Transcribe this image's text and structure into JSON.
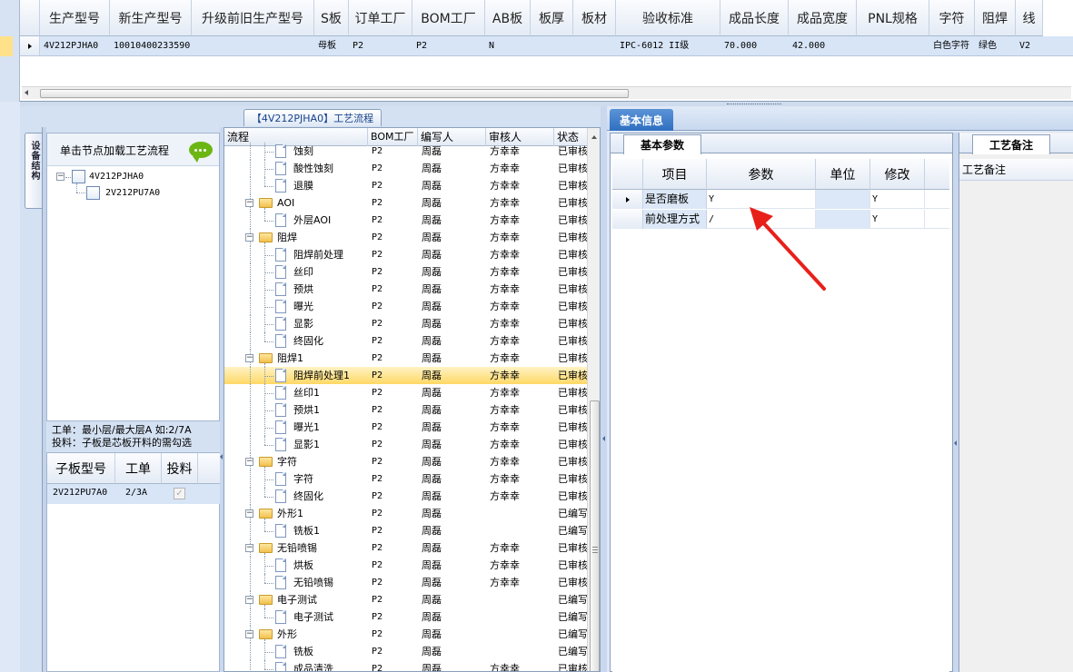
{
  "top_grid": {
    "columns": [
      "生产型号",
      "新生产型号",
      "升级前旧生产型号",
      "S板",
      "订单工厂",
      "BOM工厂",
      "AB板",
      "板厚",
      "板材",
      "验收标准",
      "成品长度",
      "成品宽度",
      "PNL规格",
      "字符",
      "阻焊",
      "线"
    ],
    "row": [
      "4V212PJHA0",
      "10010400233590",
      "",
      "母板",
      "P2",
      "P2",
      "N",
      "",
      "",
      "IPC-6012 II级",
      "70.000",
      "42.000",
      "",
      "白色字符",
      "绿色",
      "V2"
    ]
  },
  "left_panel": {
    "vertical_tab": "设备结构",
    "process_tab_title": "【4V212PJHA0】工艺流程",
    "node_hint": "单击节点加载工艺流程",
    "tree": [
      {
        "label": "4V212PJHA0"
      },
      {
        "label": "2V212PU7A0"
      }
    ],
    "info_line1": "工单：最小层/最大层A 如:2/7A",
    "info_line2": "投料：子板是芯板开料的需勾选",
    "sub_grid": {
      "columns": [
        "子板型号",
        "工单",
        "投料"
      ],
      "rows": [
        {
          "model": "2V212PU7A0",
          "order": "2/3A",
          "feed_checked": true
        }
      ]
    }
  },
  "process_tree": {
    "columns": [
      "流程",
      "BOM工厂",
      "编写人",
      "审核人",
      "状态"
    ],
    "rows": [
      {
        "level": 2,
        "kind": "doc",
        "name": "蚀刻",
        "bom": "P2",
        "writer": "周磊",
        "reviewer": "方幸幸",
        "status": "已审核"
      },
      {
        "level": 2,
        "kind": "doc",
        "name": "酸性蚀刻",
        "bom": "P2",
        "writer": "周磊",
        "reviewer": "方幸幸",
        "status": "已审核"
      },
      {
        "level": 2,
        "kind": "doc",
        "name": "退膜",
        "bom": "P2",
        "writer": "周磊",
        "reviewer": "方幸幸",
        "status": "已审核"
      },
      {
        "level": 1,
        "kind": "folder",
        "name": "AOI",
        "bom": "P2",
        "writer": "周磊",
        "reviewer": "方幸幸",
        "status": "已审核"
      },
      {
        "level": 2,
        "kind": "doc",
        "name": "外层AOI",
        "bom": "P2",
        "writer": "周磊",
        "reviewer": "方幸幸",
        "status": "已审核"
      },
      {
        "level": 1,
        "kind": "folder",
        "name": "阻焊",
        "bom": "P2",
        "writer": "周磊",
        "reviewer": "方幸幸",
        "status": "已审核"
      },
      {
        "level": 2,
        "kind": "doc",
        "name": "阻焊前处理",
        "bom": "P2",
        "writer": "周磊",
        "reviewer": "方幸幸",
        "status": "已审核"
      },
      {
        "level": 2,
        "kind": "doc",
        "name": "丝印",
        "bom": "P2",
        "writer": "周磊",
        "reviewer": "方幸幸",
        "status": "已审核"
      },
      {
        "level": 2,
        "kind": "doc",
        "name": "预烘",
        "bom": "P2",
        "writer": "周磊",
        "reviewer": "方幸幸",
        "status": "已审核"
      },
      {
        "level": 2,
        "kind": "doc",
        "name": "曝光",
        "bom": "P2",
        "writer": "周磊",
        "reviewer": "方幸幸",
        "status": "已审核"
      },
      {
        "level": 2,
        "kind": "doc",
        "name": "显影",
        "bom": "P2",
        "writer": "周磊",
        "reviewer": "方幸幸",
        "status": "已审核"
      },
      {
        "level": 2,
        "kind": "doc",
        "name": "终固化",
        "bom": "P2",
        "writer": "周磊",
        "reviewer": "方幸幸",
        "status": "已审核"
      },
      {
        "level": 1,
        "kind": "folder",
        "name": "阻焊1",
        "bom": "P2",
        "writer": "周磊",
        "reviewer": "方幸幸",
        "status": "已审核"
      },
      {
        "level": 2,
        "kind": "doc",
        "name": "阻焊前处理1",
        "bom": "P2",
        "writer": "周磊",
        "reviewer": "方幸幸",
        "status": "已审核",
        "selected": true
      },
      {
        "level": 2,
        "kind": "doc",
        "name": "丝印1",
        "bom": "P2",
        "writer": "周磊",
        "reviewer": "方幸幸",
        "status": "已审核"
      },
      {
        "level": 2,
        "kind": "doc",
        "name": "预烘1",
        "bom": "P2",
        "writer": "周磊",
        "reviewer": "方幸幸",
        "status": "已审核"
      },
      {
        "level": 2,
        "kind": "doc",
        "name": "曝光1",
        "bom": "P2",
        "writer": "周磊",
        "reviewer": "方幸幸",
        "status": "已审核"
      },
      {
        "level": 2,
        "kind": "doc",
        "name": "显影1",
        "bom": "P2",
        "writer": "周磊",
        "reviewer": "方幸幸",
        "status": "已审核"
      },
      {
        "level": 1,
        "kind": "folder",
        "name": "字符",
        "bom": "P2",
        "writer": "周磊",
        "reviewer": "方幸幸",
        "status": "已审核"
      },
      {
        "level": 2,
        "kind": "doc",
        "name": "字符",
        "bom": "P2",
        "writer": "周磊",
        "reviewer": "方幸幸",
        "status": "已审核"
      },
      {
        "level": 2,
        "kind": "doc",
        "name": "终固化",
        "bom": "P2",
        "writer": "周磊",
        "reviewer": "方幸幸",
        "status": "已审核"
      },
      {
        "level": 1,
        "kind": "folder",
        "name": "外形1",
        "bom": "P2",
        "writer": "周磊",
        "reviewer": "",
        "status": "已编写"
      },
      {
        "level": 2,
        "kind": "doc",
        "name": "铣板1",
        "bom": "P2",
        "writer": "周磊",
        "reviewer": "",
        "status": "已编写"
      },
      {
        "level": 1,
        "kind": "folder",
        "name": "无铅喷锡",
        "bom": "P2",
        "writer": "周磊",
        "reviewer": "方幸幸",
        "status": "已审核"
      },
      {
        "level": 2,
        "kind": "doc",
        "name": "烘板",
        "bom": "P2",
        "writer": "周磊",
        "reviewer": "方幸幸",
        "status": "已审核"
      },
      {
        "level": 2,
        "kind": "doc",
        "name": "无铅喷锡",
        "bom": "P2",
        "writer": "周磊",
        "reviewer": "方幸幸",
        "status": "已审核"
      },
      {
        "level": 1,
        "kind": "folder",
        "name": "电子测试",
        "bom": "P2",
        "writer": "周磊",
        "reviewer": "",
        "status": "已编写"
      },
      {
        "level": 2,
        "kind": "doc",
        "name": "电子测试",
        "bom": "P2",
        "writer": "周磊",
        "reviewer": "",
        "status": "已编写"
      },
      {
        "level": 1,
        "kind": "folder",
        "name": "外形",
        "bom": "P2",
        "writer": "周磊",
        "reviewer": "",
        "status": "已编写"
      },
      {
        "level": 2,
        "kind": "doc",
        "name": "铣板",
        "bom": "P2",
        "writer": "周磊",
        "reviewer": "",
        "status": "已编写"
      },
      {
        "level": 2,
        "kind": "doc",
        "name": "成品清洗",
        "bom": "P2",
        "writer": "周磊",
        "reviewer": "方幸幸",
        "status": "已审核"
      }
    ]
  },
  "right_panel": {
    "main_tab": "基本信息",
    "param_tab": "基本参数",
    "param_columns": [
      "项目",
      "参数",
      "单位",
      "修改"
    ],
    "param_rows": [
      {
        "item": "是否磨板",
        "param": "Y",
        "unit": "",
        "modify": "Y"
      },
      {
        "item": "前处理方式",
        "param": "/",
        "unit": "",
        "modify": "Y"
      }
    ],
    "note_tab": "工艺备注",
    "note_header": "工艺备注"
  },
  "colors": {
    "selected_row": "#ffd866",
    "header_bg": "#e4ebf5",
    "accent": "#2f6fc0",
    "arrow": "#e8201a"
  }
}
